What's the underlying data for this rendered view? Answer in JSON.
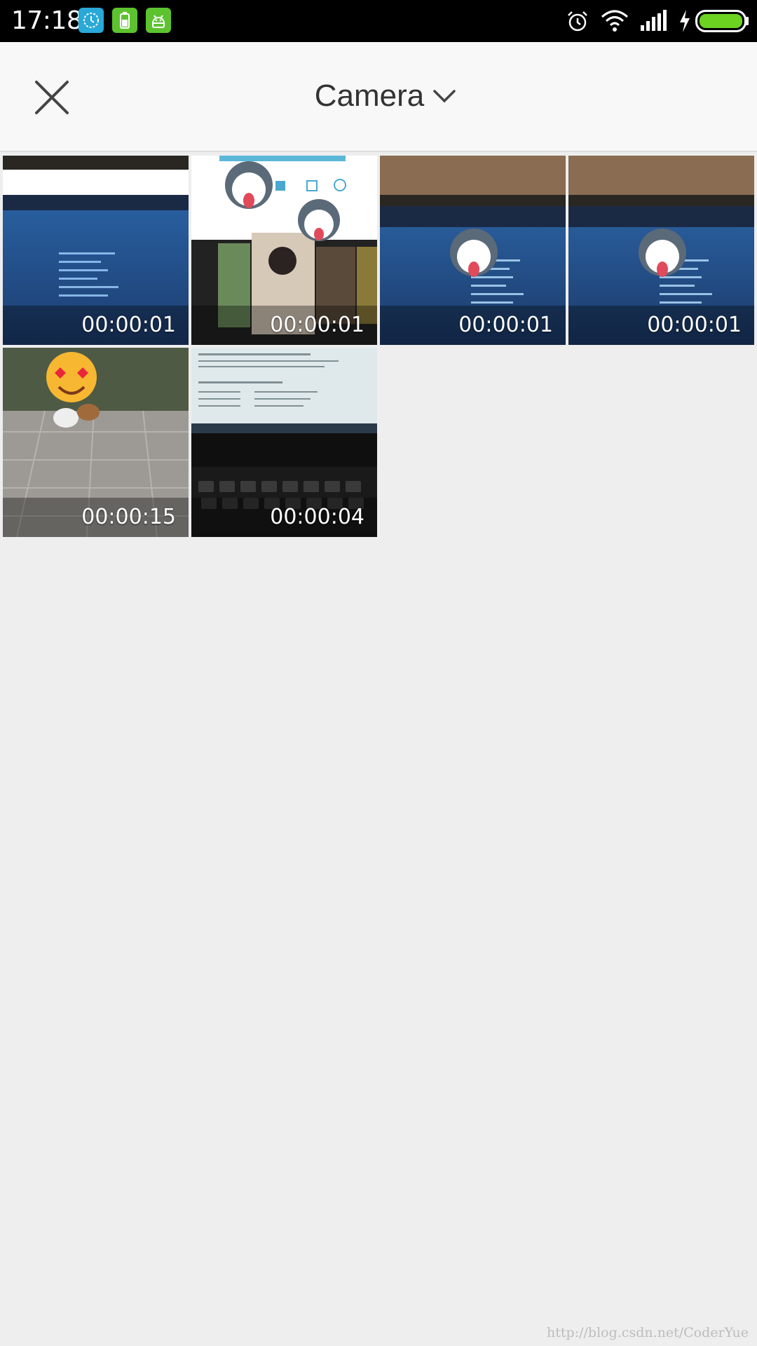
{
  "status_bar": {
    "time": "17:18",
    "notification_icons": [
      "history-app-icon",
      "battery-app-icon",
      "android-app-icon"
    ],
    "system_icons": [
      "alarm-icon",
      "wifi-icon",
      "signal-icon",
      "charging-icon",
      "battery-icon"
    ],
    "battery_level": 1.0,
    "colors": {
      "app1": "#29a9d8",
      "app2": "#5cc32e",
      "app3": "#5cc32e",
      "battery": "#6cd321"
    }
  },
  "header": {
    "title": "Camera",
    "close_icon": "close-icon",
    "dropdown_icon": "chevron-down-icon"
  },
  "videos": [
    {
      "duration": "00:00:01"
    },
    {
      "duration": "00:00:01"
    },
    {
      "duration": "00:00:01"
    },
    {
      "duration": "00:00:01"
    },
    {
      "duration": "00:00:15"
    },
    {
      "duration": "00:00:04"
    }
  ],
  "watermark": "http://blog.csdn.net/CoderYue"
}
